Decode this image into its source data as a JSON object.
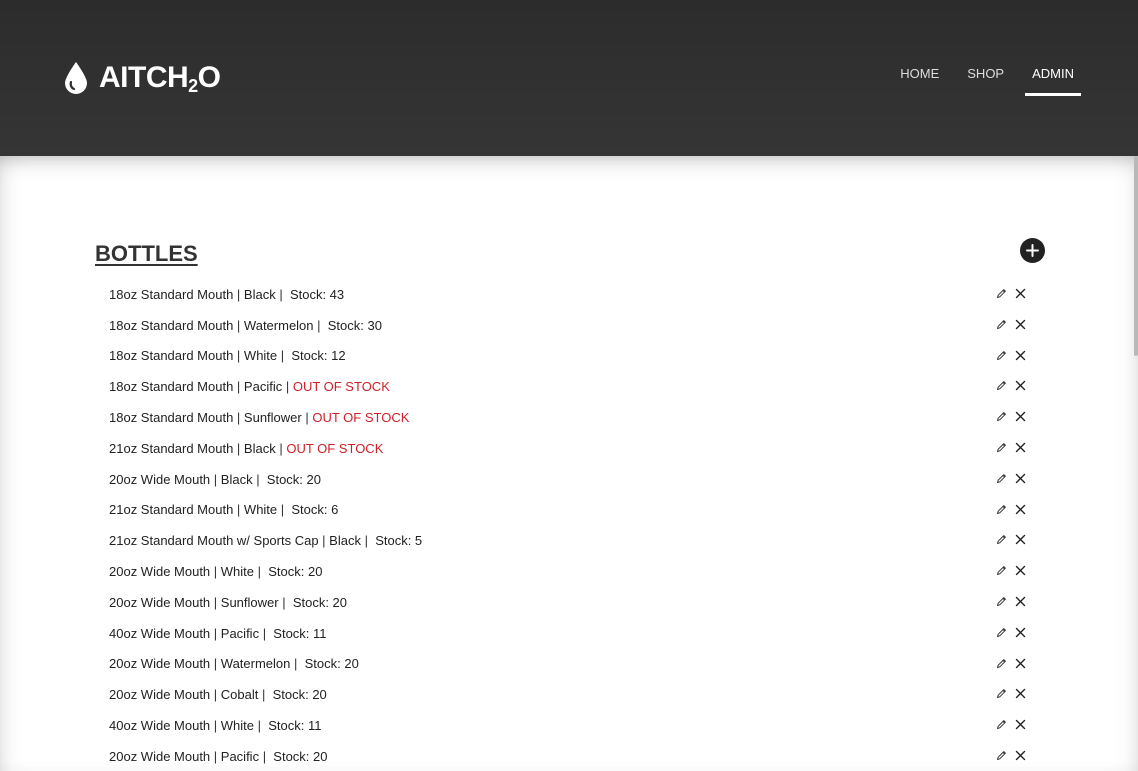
{
  "header": {
    "logo_main": "AITCH",
    "logo_sub": "2",
    "logo_end": "O",
    "nav": [
      {
        "label": "HOME",
        "active": false
      },
      {
        "label": "SHOP",
        "active": false
      },
      {
        "label": "ADMIN",
        "active": true
      }
    ]
  },
  "section": {
    "title": "BOTTLES",
    "add_icon": "plus-circle-icon",
    "edit_icon": "pencil-icon",
    "delete_icon": "close-icon",
    "oos_color": "#d0202a",
    "items": [
      {
        "name": "18oz Standard Mouth",
        "color": "Black",
        "stock_label": "Stock: 43",
        "out_of_stock": false
      },
      {
        "name": "18oz Standard Mouth",
        "color": "Watermelon",
        "stock_label": "Stock: 30",
        "out_of_stock": false
      },
      {
        "name": "18oz Standard Mouth",
        "color": "White",
        "stock_label": "Stock: 12",
        "out_of_stock": false
      },
      {
        "name": "18oz Standard Mouth",
        "color": "Pacific",
        "stock_label": "OUT OF STOCK",
        "out_of_stock": true
      },
      {
        "name": "18oz Standard Mouth",
        "color": "Sunflower",
        "stock_label": "OUT OF STOCK",
        "out_of_stock": true
      },
      {
        "name": "21oz Standard Mouth",
        "color": "Black",
        "stock_label": "OUT OF STOCK",
        "out_of_stock": true
      },
      {
        "name": "20oz Wide Mouth",
        "color": "Black",
        "stock_label": "Stock: 20",
        "out_of_stock": false
      },
      {
        "name": "21oz Standard Mouth",
        "color": "White",
        "stock_label": "Stock: 6",
        "out_of_stock": false
      },
      {
        "name": "21oz Standard Mouth w/ Sports Cap",
        "color": "Black",
        "stock_label": "Stock: 5",
        "out_of_stock": false
      },
      {
        "name": "20oz Wide Mouth",
        "color": "White",
        "stock_label": "Stock: 20",
        "out_of_stock": false
      },
      {
        "name": "20oz Wide Mouth",
        "color": "Sunflower",
        "stock_label": "Stock: 20",
        "out_of_stock": false
      },
      {
        "name": "40oz Wide Mouth",
        "color": "Pacific",
        "stock_label": "Stock: 11",
        "out_of_stock": false
      },
      {
        "name": "20oz Wide Mouth",
        "color": "Watermelon",
        "stock_label": "Stock: 20",
        "out_of_stock": false
      },
      {
        "name": "20oz Wide Mouth",
        "color": "Cobalt",
        "stock_label": "Stock: 20",
        "out_of_stock": false
      },
      {
        "name": "40oz Wide Mouth",
        "color": "White",
        "stock_label": "Stock: 11",
        "out_of_stock": false
      },
      {
        "name": "20oz Wide Mouth",
        "color": "Pacific",
        "stock_label": "Stock: 20",
        "out_of_stock": false
      }
    ]
  }
}
